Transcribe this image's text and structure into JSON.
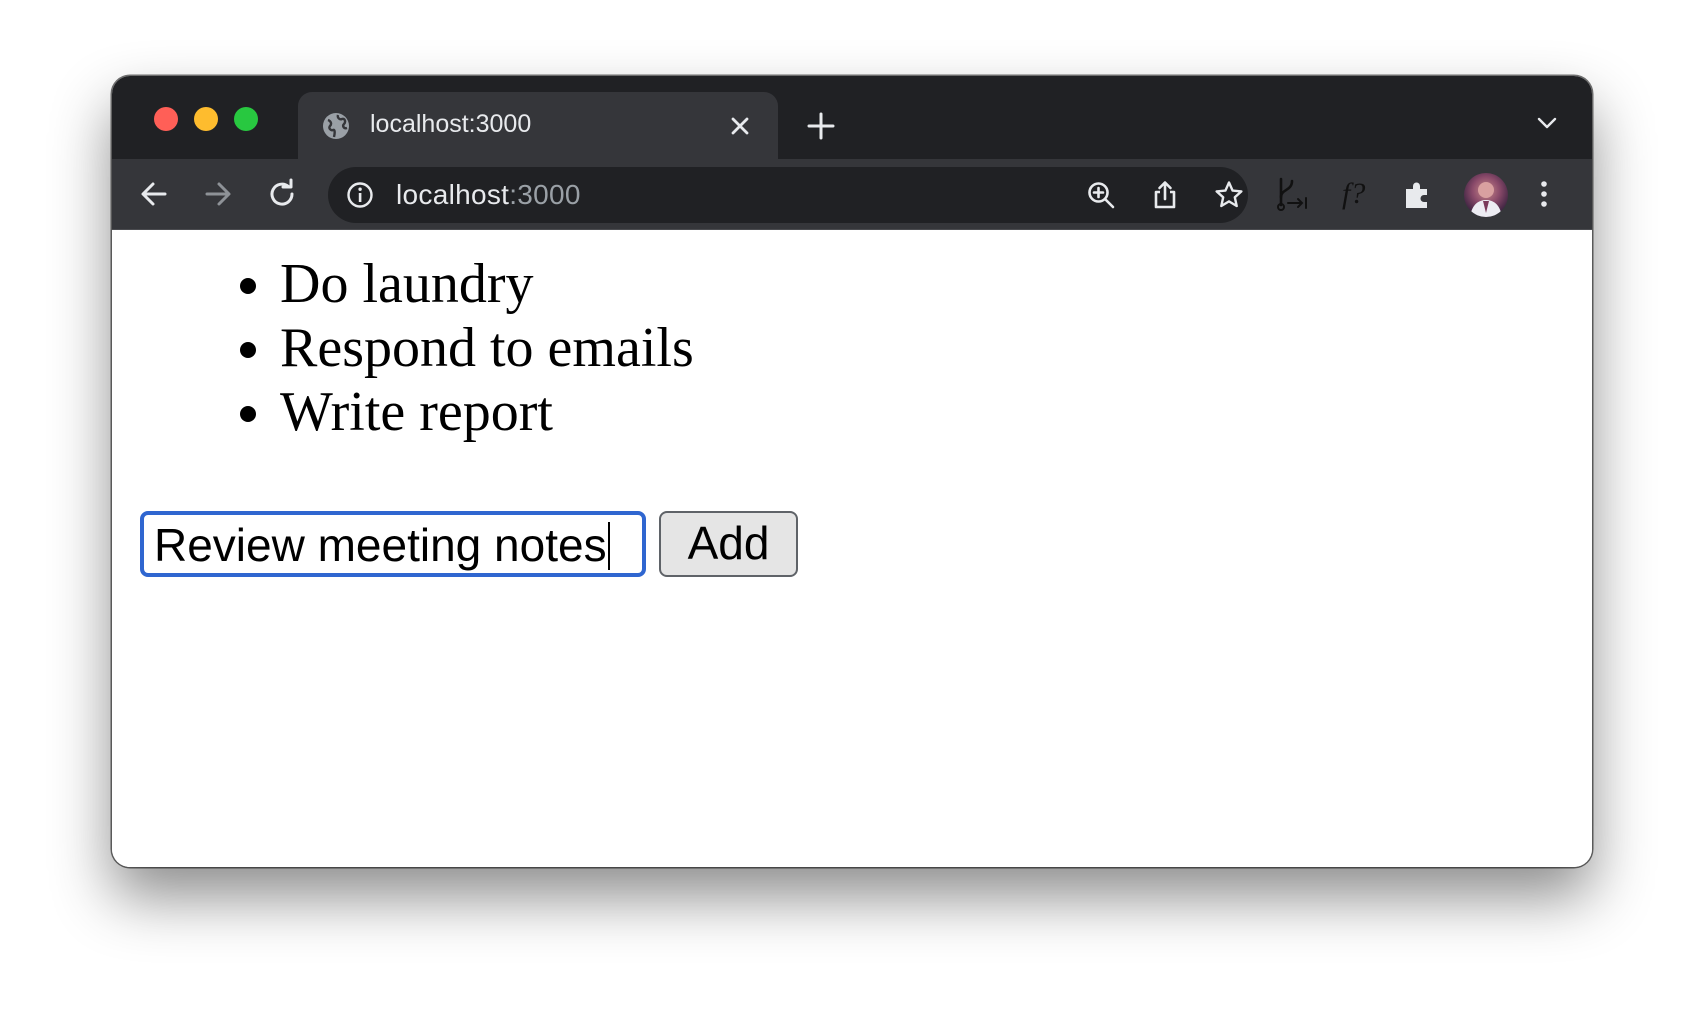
{
  "browser": {
    "tab": {
      "title": "localhost:3000",
      "favicon": "globe-icon",
      "close_icon": "close-icon"
    },
    "new_tab_icon": "plus-icon",
    "tab_search_icon": "chevron-down-icon",
    "toolbar": {
      "back_icon": "arrow-left-icon",
      "forward_icon": "arrow-right-icon",
      "reload_icon": "reload-icon",
      "address": {
        "host": "localhost",
        "port": ":3000",
        "info_icon": "info-icon",
        "zoom_icon": "zoom-in-icon",
        "share_icon": "share-icon",
        "bookmark_icon": "star-icon"
      },
      "extensions": [
        "git-branch-extension-icon",
        "function-extension-icon",
        "puzzle-extensions-icon"
      ],
      "profile": "avatar",
      "menu_icon": "kebab-menu-icon"
    },
    "colors": {
      "tabstrip": "#202124",
      "toolbar": "#35363a",
      "omnibox": "#202124",
      "focus_ring": "#2f66d0"
    }
  },
  "page": {
    "todos": [
      {
        "text": "Do laundry"
      },
      {
        "text": "Respond to emails"
      },
      {
        "text": "Write report"
      }
    ],
    "new_todo_input": {
      "value": "Review meeting notes",
      "focused": true
    },
    "add_button_label": "Add"
  }
}
